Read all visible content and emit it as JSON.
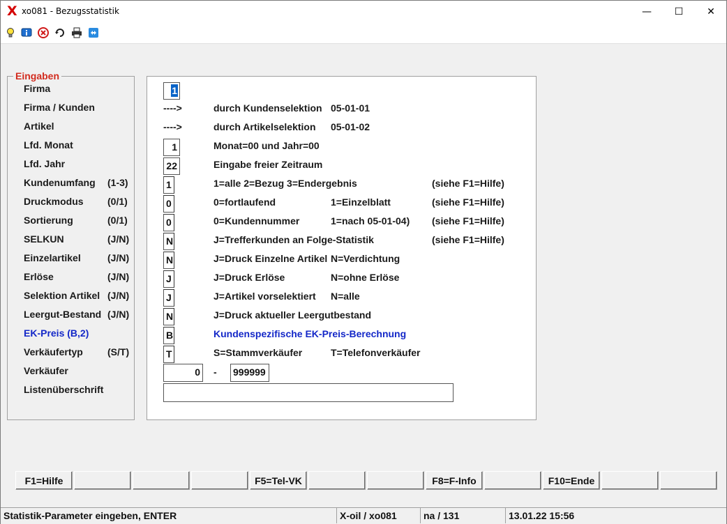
{
  "window": {
    "title": "xo081 - Bezugsstatistik",
    "app_icon": "X",
    "controls": {
      "minimize": "—",
      "maximize": "☐",
      "close": "✕"
    }
  },
  "toolbar": {
    "icons": [
      "lightbulb-icon",
      "info-icon",
      "stop-icon",
      "refresh-icon",
      "printer-icon",
      "remote-icon"
    ]
  },
  "group": {
    "legend": "Eingaben"
  },
  "labels": [
    {
      "text": "Firma",
      "range": ""
    },
    {
      "text": "Firma / Kunden",
      "range": ""
    },
    {
      "text": "Artikel",
      "range": ""
    },
    {
      "text": "Lfd. Monat",
      "range": ""
    },
    {
      "text": "Lfd. Jahr",
      "range": ""
    },
    {
      "text": "Kundenumfang",
      "range": "(1-3)"
    },
    {
      "text": "Druckmodus",
      "range": "(0/1)"
    },
    {
      "text": "Sortierung",
      "range": "(0/1)"
    },
    {
      "text": "SELKUN",
      "range": "(J/N)"
    },
    {
      "text": "Einzelartikel",
      "range": "(J/N)"
    },
    {
      "text": "Erlöse",
      "range": "(J/N)"
    },
    {
      "text": "Selektion Artikel",
      "range": "(J/N)"
    },
    {
      "text": "Leergut-Bestand",
      "range": "(J/N)"
    },
    {
      "text": "EK-Preis (B,2)",
      "range": ""
    },
    {
      "text": "Verkäufertyp",
      "range": "(S/T)"
    },
    {
      "text": "Verkäufer",
      "range": ""
    },
    {
      "text": "Listenüberschrift",
      "range": ""
    }
  ],
  "fields": {
    "firma": "1",
    "monat": "1",
    "jahr": "22",
    "kundenumfang": "1",
    "druckmodus": "0",
    "sortierung": "0",
    "selkun": "N",
    "einzelartikel": "N",
    "erloese": "J",
    "selektion_artikel": "J",
    "leergut": "N",
    "ek_preis": "B",
    "verkaeufertyp": "T",
    "verkaeufer_von": "0",
    "verkaeufer_dash": "-",
    "verkaeufer_bis": "999999",
    "listenueberschrift": ""
  },
  "rows": {
    "firma_kunden": {
      "arrow": "---->",
      "desc": "durch Kundenselektion",
      "code": "05-01-01"
    },
    "artikel": {
      "arrow": "---->",
      "desc": "durch Artikelselektion",
      "code": "05-01-02"
    },
    "monat": {
      "desc": "Monat=00 und Jahr=00"
    },
    "jahr": {
      "desc": "Eingabe freier Zeitraum"
    },
    "kundenumfang": {
      "desc": "1=alle  2=Bezug  3=Endergebnis",
      "help": "(siehe F1=Hilfe)"
    },
    "druckmodus": {
      "desc": "0=fortlaufend",
      "desc2": "1=Einzelblatt",
      "help": "(siehe F1=Hilfe)"
    },
    "sortierung": {
      "desc": "0=Kundennummer",
      "desc2": "1=nach 05-01-04)",
      "help": "(siehe F1=Hilfe)"
    },
    "selkun": {
      "desc": "J=Trefferkunden an Folge-Statistik",
      "help": "(siehe F1=Hilfe)"
    },
    "einzelartikel": {
      "desc": "J=Druck Einzelne Artikel",
      "desc2": "N=Verdichtung"
    },
    "erloese": {
      "desc": "J=Druck Erlöse",
      "desc2": "N=ohne Erlöse"
    },
    "selektion_artikel": {
      "desc": "J=Artikel vorselektiert",
      "desc2": "N=alle"
    },
    "leergut": {
      "desc": "J=Druck aktueller Leergutbestand"
    },
    "ek_preis": {
      "desc": "Kundenspezifische EK-Preis-Berechnung"
    },
    "verkaeufertyp": {
      "desc": "S=Stammverkäufer",
      "desc2": "T=Telefonverkäufer"
    }
  },
  "fkeys": [
    "F1=Hilfe",
    "",
    "",
    "",
    "F5=Tel-VK",
    "",
    "",
    "F8=F-Info",
    "",
    "F10=Ende",
    "",
    ""
  ],
  "status": {
    "message": "Statistik-Parameter eingeben, ENTER",
    "program": "X-oil / xo081",
    "user": "na / 131",
    "datetime": "13.01.22 15:56"
  },
  "colors": {
    "legend": "#d22b1e",
    "highlight_blue": "#1428c8",
    "selection": "#0a64c8"
  }
}
